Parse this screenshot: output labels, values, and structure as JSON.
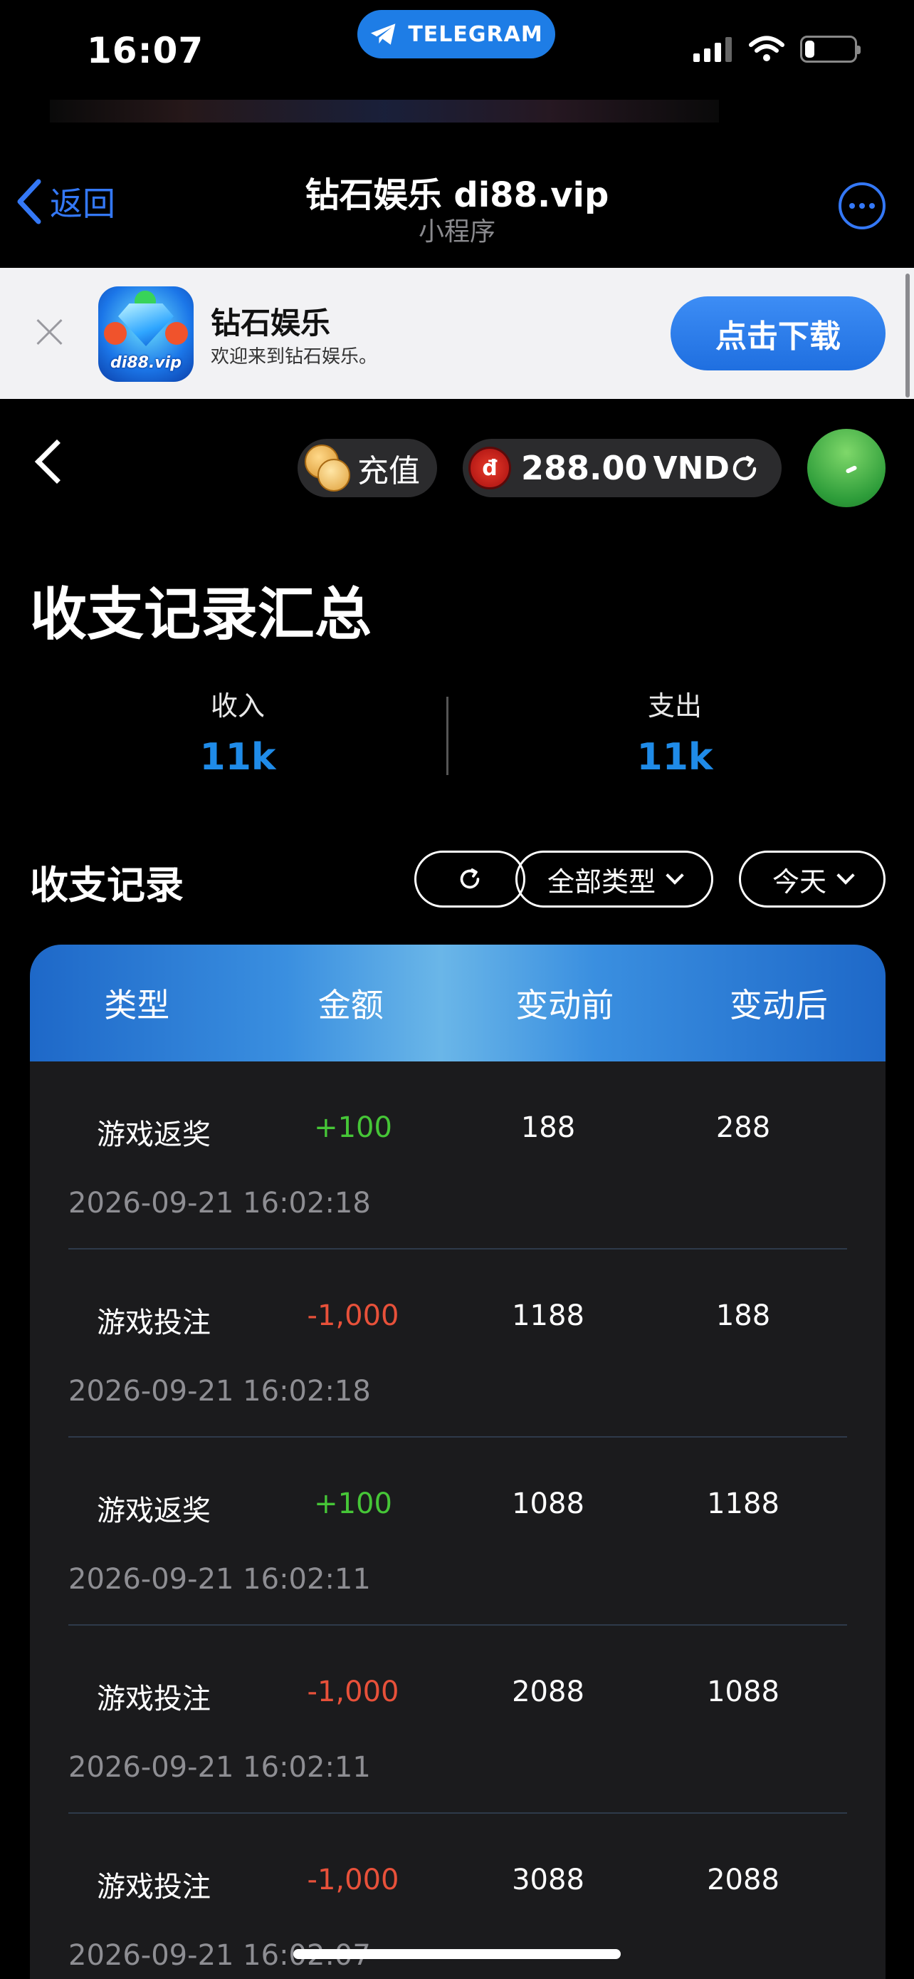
{
  "status_bar": {
    "time": "16:07",
    "telegram_label": "TELEGRAM",
    "battery_level": 0.2
  },
  "nav": {
    "back_label": "返回",
    "title": "钻石娱乐 di88.vip",
    "subtitle": "小程序"
  },
  "banner": {
    "app_name": "钻石娱乐",
    "description": "欢迎来到钻石娱乐。",
    "download_label": "点击下载",
    "icon_text": "di88.vip"
  },
  "header": {
    "recharge_label": "充值",
    "dong_symbol": "đ",
    "balance": "288.00",
    "currency": "VND"
  },
  "summary": {
    "title": "收支记录汇总",
    "income_label": "收入",
    "income_value": "11k",
    "expense_label": "支出",
    "expense_value": "11k"
  },
  "records": {
    "title": "收支记录",
    "type_filter": "全部类型",
    "date_filter": "今天",
    "columns": [
      "类型",
      "金额",
      "变动前",
      "变动后"
    ],
    "rows": [
      {
        "type": "游戏返奖",
        "amount": "+100",
        "before": "188",
        "after": "288",
        "time": "2026-09-21 16:02:18"
      },
      {
        "type": "游戏投注",
        "amount": "-1,000",
        "before": "1188",
        "after": "188",
        "time": "2026-09-21 16:02:18"
      },
      {
        "type": "游戏返奖",
        "amount": "+100",
        "before": "1088",
        "after": "1188",
        "time": "2026-09-21 16:02:11"
      },
      {
        "type": "游戏投注",
        "amount": "-1,000",
        "before": "2088",
        "after": "1088",
        "time": "2026-09-21 16:02:11"
      },
      {
        "type": "游戏投注",
        "amount": "-1,000",
        "before": "3088",
        "after": "2088",
        "time": "2026-09-21 16:02:07"
      }
    ]
  },
  "colors": {
    "accent": "#1f8be8",
    "positive": "#46c637",
    "negative": "#e8513a",
    "telegram": "#1e7de6"
  }
}
